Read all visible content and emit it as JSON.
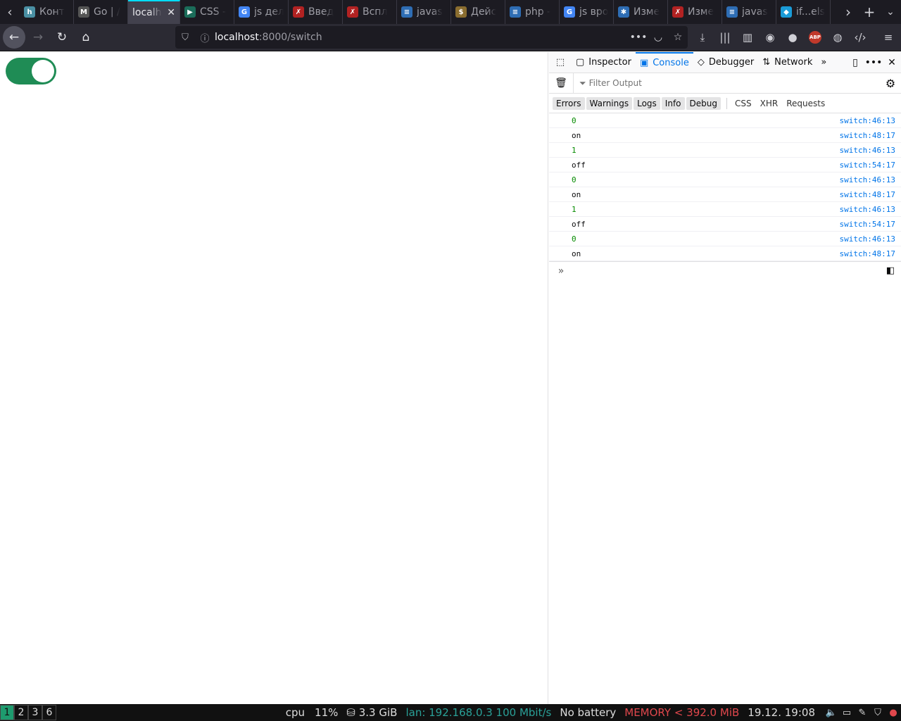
{
  "tabs": [
    {
      "title": "Конт",
      "fav": "h",
      "fav_bg": "#4a90a4"
    },
    {
      "title": "Go | /",
      "fav": "M",
      "fav_bg": "#555"
    },
    {
      "title": "localh",
      "fav": "",
      "fav_bg": "transparent",
      "active": true
    },
    {
      "title": "CSS -",
      "fav": "▶",
      "fav_bg": "#1b6d5a"
    },
    {
      "title": "js дел",
      "fav": "G",
      "fav_bg": "#4285f4"
    },
    {
      "title": "Введ",
      "fav": "✗",
      "fav_bg": "#b22222"
    },
    {
      "title": "Вспл",
      "fav": "✗",
      "fav_bg": "#b22222"
    },
    {
      "title": "javas",
      "fav": "≡",
      "fav_bg": "#2e6db4"
    },
    {
      "title": "Дейс",
      "fav": "$",
      "fav_bg": "#8a6d2f"
    },
    {
      "title": "php -",
      "fav": "≡",
      "fav_bg": "#2e6db4"
    },
    {
      "title": "js вро",
      "fav": "G",
      "fav_bg": "#4285f4"
    },
    {
      "title": "Изме",
      "fav": "✱",
      "fav_bg": "#2e6db4"
    },
    {
      "title": "Изме",
      "fav": "✗",
      "fav_bg": "#b22222"
    },
    {
      "title": "javas",
      "fav": "≡",
      "fav_bg": "#2e6db4"
    },
    {
      "title": "if...els",
      "fav": "◆",
      "fav_bg": "#1a9bd7"
    }
  ],
  "urlbar": {
    "host": "localhost",
    "path": ":8000/switch"
  },
  "devtools": {
    "tabs": {
      "inspector": "Inspector",
      "console": "Console",
      "debugger": "Debugger",
      "network": "Network"
    },
    "filter_placeholder": "Filter Output",
    "categories": [
      "Errors",
      "Warnings",
      "Logs",
      "Info",
      "Debug"
    ],
    "extra_categories": [
      "CSS",
      "XHR",
      "Requests"
    ],
    "logs": [
      {
        "msg": "0",
        "src": "switch:46:13",
        "num": true
      },
      {
        "msg": "on",
        "src": "switch:48:17",
        "num": false
      },
      {
        "msg": "1",
        "src": "switch:46:13",
        "num": true
      },
      {
        "msg": "off",
        "src": "switch:54:17",
        "num": false
      },
      {
        "msg": "0",
        "src": "switch:46:13",
        "num": true
      },
      {
        "msg": "on",
        "src": "switch:48:17",
        "num": false
      },
      {
        "msg": "1",
        "src": "switch:46:13",
        "num": true
      },
      {
        "msg": "off",
        "src": "switch:54:17",
        "num": false
      },
      {
        "msg": "0",
        "src": "switch:46:13",
        "num": true
      },
      {
        "msg": "on",
        "src": "switch:48:17",
        "num": false
      }
    ]
  },
  "switch": {
    "state": "on",
    "color": "#1f8c55"
  },
  "statusbar": {
    "workspaces": [
      "1",
      "2",
      "3",
      "6"
    ],
    "cpu_label": "cpu",
    "cpu_value": "11%",
    "disk": "3.3 GiB",
    "lan": "lan: 192.168.0.3 100 Mbit/s",
    "battery": "No battery",
    "memory": "MEMORY < 392.0 MiB",
    "clock": "19.12. 19:08"
  }
}
